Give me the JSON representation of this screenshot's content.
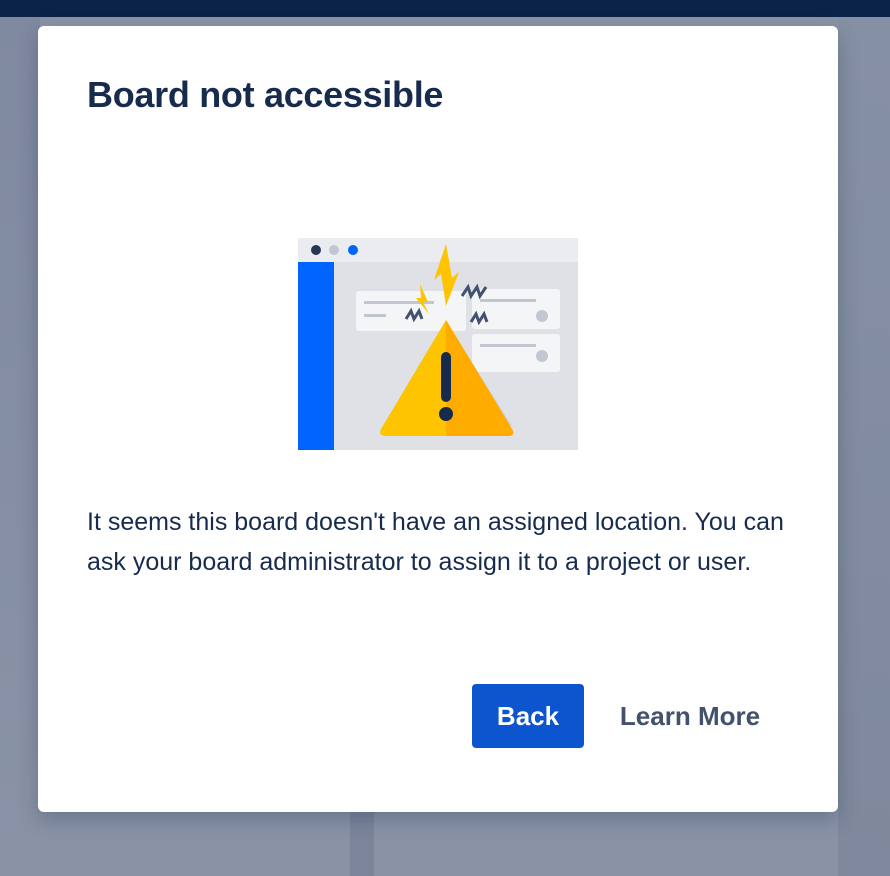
{
  "modal": {
    "title": "Board not accessible",
    "message": "It seems this board doesn't have an assigned location. You can ask your board administrator to assign it to a project or user.",
    "illustration_icon": "warning-triangle-icon",
    "buttons": {
      "back_label": "Back",
      "learn_more_label": "Learn More"
    }
  },
  "colors": {
    "primary_button": "#0c55cf",
    "title_text": "#172b4d",
    "warning": "#ffab00",
    "topbar": "#0b2349",
    "overlay": "#8a93a6"
  }
}
